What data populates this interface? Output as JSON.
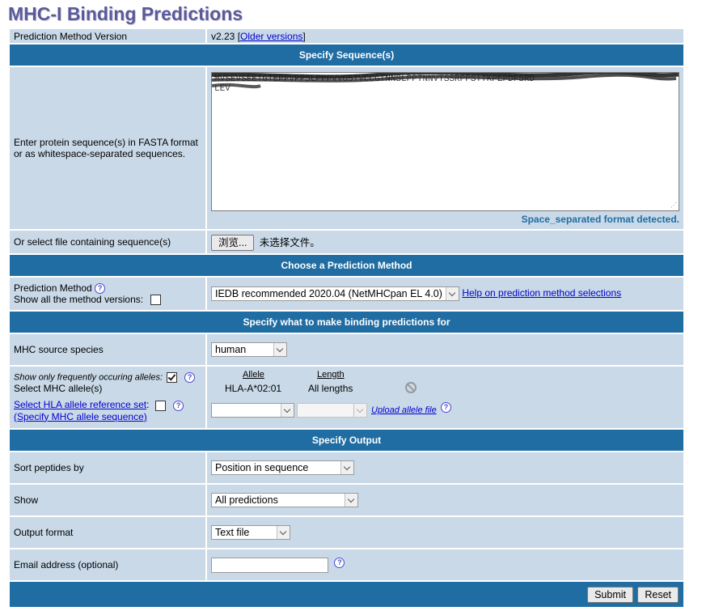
{
  "page_title": "MHC-I Binding Predictions",
  "version_row": {
    "label": "Prediction Method Version",
    "version": "v2.23",
    "bracket_open": "[",
    "older_link": "Older versions",
    "bracket_close": "]"
  },
  "section_sequence": {
    "header": "Specify Sequence(s)",
    "enter_label_1": "Enter protein sequence(s) in FASTA format",
    "enter_label_2": "or as whitespace-separated sequences.",
    "textarea_line1": "MVSEVSEETGTEPPVPPSLPPPVVGSTVCCGTNNSLPPTNNVTSSRPPSTTKPEPDFSRD",
    "textarea_line2": "LEV",
    "detected_text": "Space_separated format detected.",
    "file_label": "Or select file containing sequence(s)",
    "browse_button": "浏览...",
    "no_file_text": "未选择文件。"
  },
  "section_method": {
    "header": "Choose a Prediction Method",
    "method_label": "Prediction Method",
    "show_versions_label": "Show all the method versions:",
    "method_value": "IEDB recommended 2020.04 (NetMHCpan EL 4.0)",
    "help_link": "Help on prediction method selections",
    "help_icon": "?"
  },
  "section_binding": {
    "header": "Specify what to make binding predictions for",
    "species_label": "MHC source species",
    "species_value": "human",
    "frequent_label": "Show only frequently occuring alleles:",
    "select_allele_label": "Select MHC allele(s)",
    "ref_set_link": "Select HLA allele reference set",
    "ref_set_colon": ":",
    "specify_link": "(Specify MHC allele sequence)",
    "allele_header": "Allele",
    "length_header": "Length",
    "allele_value": "HLA-A*02:01",
    "length_value": "All lengths",
    "upload_link": "Upload allele file"
  },
  "section_output": {
    "header": "Specify Output",
    "sort_label": "Sort peptides by",
    "sort_value": "Position in sequence",
    "show_label": "Show",
    "show_value": "All predictions",
    "format_label": "Output format",
    "format_value": "Text file",
    "email_label": "Email address (optional)",
    "email_value": ""
  },
  "buttons": {
    "submit": "Submit",
    "reset": "Reset"
  },
  "colors": {
    "header_bg": "#1f6da3",
    "row_bg": "#c9d9e8",
    "title": "#5a5a9a"
  }
}
